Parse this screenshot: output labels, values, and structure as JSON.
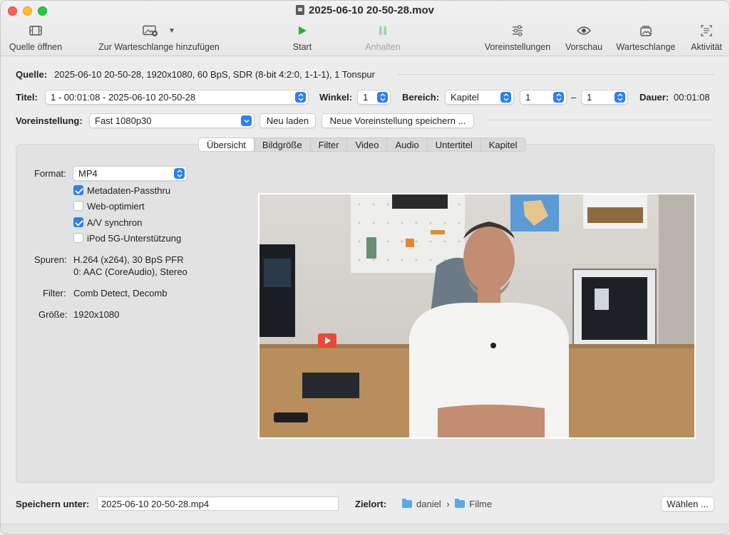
{
  "window": {
    "title": "2025-06-10 20-50-28.mov"
  },
  "toolbar": {
    "open_source": "Quelle öffnen",
    "add_to_queue": "Zur Warteschlange hinzufügen",
    "start": "Start",
    "pause": "Anhalten",
    "presets": "Voreinstellungen",
    "preview": "Vorschau",
    "queue": "Warteschlange",
    "activity": "Aktivität"
  },
  "source": {
    "label": "Quelle:",
    "value": "2025-06-10 20-50-28, 1920x1080, 60 BpS, SDR (8-bit 4:2:0, 1-1-1), 1 Tonspur"
  },
  "title_row": {
    "title_label": "Titel:",
    "title_value": "1 - 00:01:08 - 2025-06-10 20-50-28",
    "angle_label": "Winkel:",
    "angle_value": "1",
    "range_label": "Bereich:",
    "range_type": "Kapitel",
    "range_start": "1",
    "range_sep": "–",
    "range_end": "1",
    "duration_label": "Dauer:",
    "duration_value": "00:01:08"
  },
  "preset_row": {
    "label": "Voreinstellung:",
    "value": "Fast 1080p30",
    "reload": "Neu laden",
    "save_new": "Neue Voreinstellung speichern ..."
  },
  "tabs": [
    "Übersicht",
    "Bildgröße",
    "Filter",
    "Video",
    "Audio",
    "Untertitel",
    "Kapitel"
  ],
  "summary": {
    "format_label": "Format:",
    "format_value": "MP4",
    "checkboxes": [
      {
        "label": "Metadaten-Passthru",
        "checked": true
      },
      {
        "label": "Web-optimiert",
        "checked": false
      },
      {
        "label": "A/V synchron",
        "checked": true
      },
      {
        "label": "iPod 5G-Unterstützung",
        "checked": false
      }
    ],
    "tracks_label": "Spuren:",
    "tracks_line1": "H.264 (x264), 30 BpS PFR",
    "tracks_line2": "0: AAC (CoreAudio), Stereo",
    "filter_label": "Filter:",
    "filter_value": "Comb Detect, Decomb",
    "size_label": "Größe:",
    "size_value": "1920x1080"
  },
  "footer": {
    "save_label": "Speichern unter:",
    "save_value": "2025-06-10 20-50-28.mp4",
    "dest_label": "Zielort:",
    "dest_folder1": "daniel",
    "dest_sep": "›",
    "dest_folder2": "Filme",
    "choose": "Wählen ..."
  },
  "colors": {
    "accent": "#2d7ff5",
    "start_green": "#2fae3c"
  }
}
